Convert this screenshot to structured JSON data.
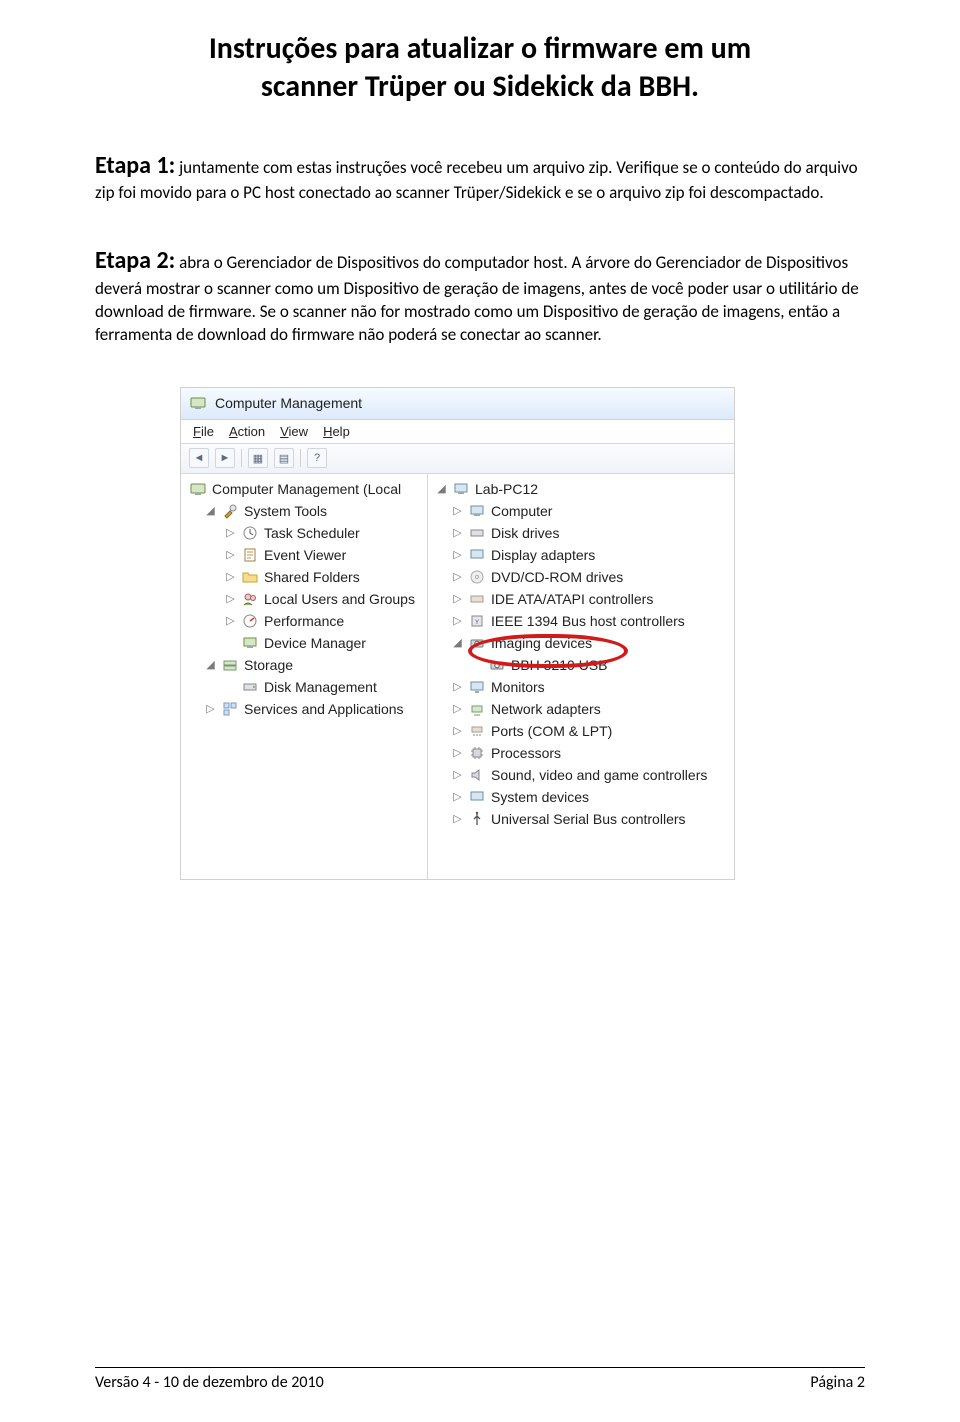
{
  "title_line1": "Instruções para atualizar o firmware em um",
  "title_line2": "scanner Trüper ou Sidekick da BBH.",
  "step1_label": "Etapa 1:",
  "step1_text": " juntamente com estas instruções você recebeu um arquivo zip. Verifique se o conteúdo do arquivo zip foi movido para o PC host conectado ao scanner Trüper/Sidekick e se o arquivo zip foi descompactado.",
  "step2_label": "Etapa 2:",
  "step2_text": " abra o Gerenciador de Dispositivos do computador host. A árvore do Gerenciador de Dispositivos deverá mostrar o scanner como um Dispositivo de geração de imagens, antes de você poder usar o utilitário de download de firmware. Se o scanner não for mostrado como um Dispositivo de geração de imagens, então a ferramenta de download do firmware não poderá se conectar ao scanner.",
  "screenshot": {
    "app_title": "Computer Management",
    "menu": {
      "file": "File",
      "action": "Action",
      "view": "View",
      "help": "Help"
    },
    "left_root": "Computer Management (Local",
    "left_items": [
      "System Tools",
      "Task Scheduler",
      "Event Viewer",
      "Shared Folders",
      "Local Users and Groups",
      "Performance",
      "Device Manager",
      "Storage",
      "Disk Management",
      "Services and Applications"
    ],
    "right_root": "Lab-PC12",
    "right_items": [
      "Computer",
      "Disk drives",
      "Display adapters",
      "DVD/CD-ROM drives",
      "IDE ATA/ATAPI controllers",
      "IEEE 1394 Bus host controllers",
      "Imaging devices",
      "BBH 3210 USB",
      "Monitors",
      "Network adapters",
      "Ports (COM & LPT)",
      "Processors",
      "Sound, video and game controllers",
      "System devices",
      "Universal Serial Bus controllers"
    ]
  },
  "footer_left": "Versão 4 - 10 de dezembro de 2010",
  "footer_right": "Página 2"
}
